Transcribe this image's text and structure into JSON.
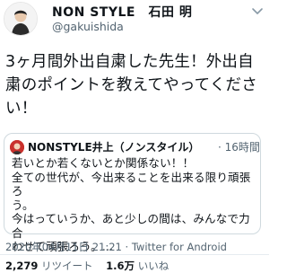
{
  "author": {
    "name": "NON STYLE　石田 明",
    "handle": "@gakuishida"
  },
  "tweet": {
    "lines": [
      "3ヶ月間外出自粛した先生！外出自",
      "粛のポイントを教えてやってくださ",
      "い！"
    ]
  },
  "quoted": {
    "name": "NONSTYLE井上（ノンスタイル）",
    "time": "· 16時間",
    "lines": [
      "若いとか若くないとか関係ない！！",
      "全ての世代が、今出来ることを出来る限り頑張ろ",
      "う。",
      "今はっていうか、あと少しの間は、みんなで力合",
      "わせて頑張ろう。..."
    ]
  },
  "meta": {
    "timestamp": "2020年04月11日 21:21",
    "separator": " · ",
    "client": "Twitter for Android"
  },
  "stats": {
    "retweets": "2,279",
    "retweet_label": "リツイート",
    "likes": "1.6万",
    "like_label": "いいね"
  },
  "colors": {
    "secondary_text": "#536471",
    "border": "#cfd9de"
  },
  "icons": {
    "menu": "chevron-down-icon"
  }
}
